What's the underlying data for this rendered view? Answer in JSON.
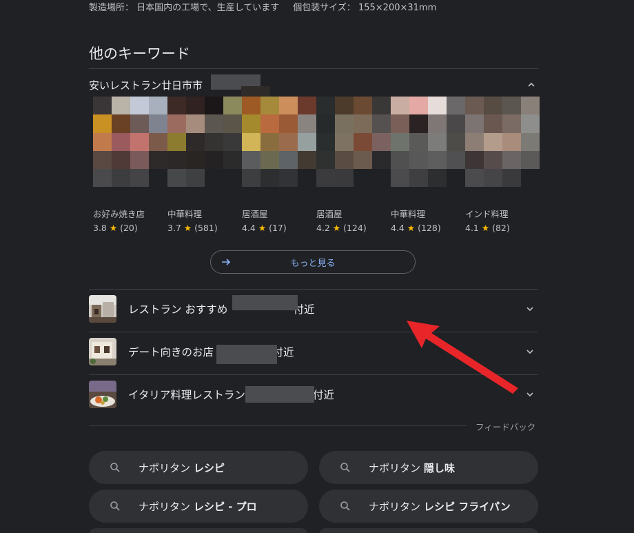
{
  "product_info": {
    "origin_label": "製造場所： 日本国内の工場で、生産しています",
    "size_label": "個包装サイズ： 155×200×31mm"
  },
  "section_title": "他のキーワード",
  "category": {
    "label": "安いレストラン廿日市市"
  },
  "restaurant_cards": [
    {
      "name": "お好み焼き店",
      "rating": "3.8",
      "reviews": "(20)"
    },
    {
      "name": "中華料理",
      "rating": "3.7",
      "reviews": "(581)"
    },
    {
      "name": "居酒屋",
      "rating": "4.4",
      "reviews": "(17)"
    },
    {
      "name": "居酒屋",
      "rating": "4.2",
      "reviews": "(124)"
    },
    {
      "name": "中華料理",
      "rating": "4.4",
      "reviews": "(128)"
    },
    {
      "name": "インド料理",
      "rating": "4.1",
      "reviews": "(82)"
    }
  ],
  "more_button": {
    "label": "もっと見る"
  },
  "keyword_rows": [
    {
      "prefix": "レストラン おすすめ",
      "suffix": "付近"
    },
    {
      "prefix": "デート向きのお店",
      "suffix": "駅付近"
    },
    {
      "prefix": "イタリア料理レストラン",
      "suffix": "付近"
    }
  ],
  "feedback_label": "フィードバック",
  "related_searches": [
    {
      "plain": "ナポリタン",
      "bold": "レシピ"
    },
    {
      "plain": "ナポリタン",
      "bold": "隠し味"
    },
    {
      "plain": "ナポリタン",
      "bold": "レシピ - プロ"
    },
    {
      "plain": "ナポリタン",
      "bold": "レシピ フライパン"
    }
  ],
  "icons": {
    "chevron": "chevron-icon",
    "arrow": "arrow-right-icon",
    "search": "search-icon"
  },
  "colors": {
    "background": "#202124",
    "link": "#8ab4f8",
    "star": "#fbbc04",
    "pill": "#303134",
    "annotation_arrow": "#e8262a"
  }
}
